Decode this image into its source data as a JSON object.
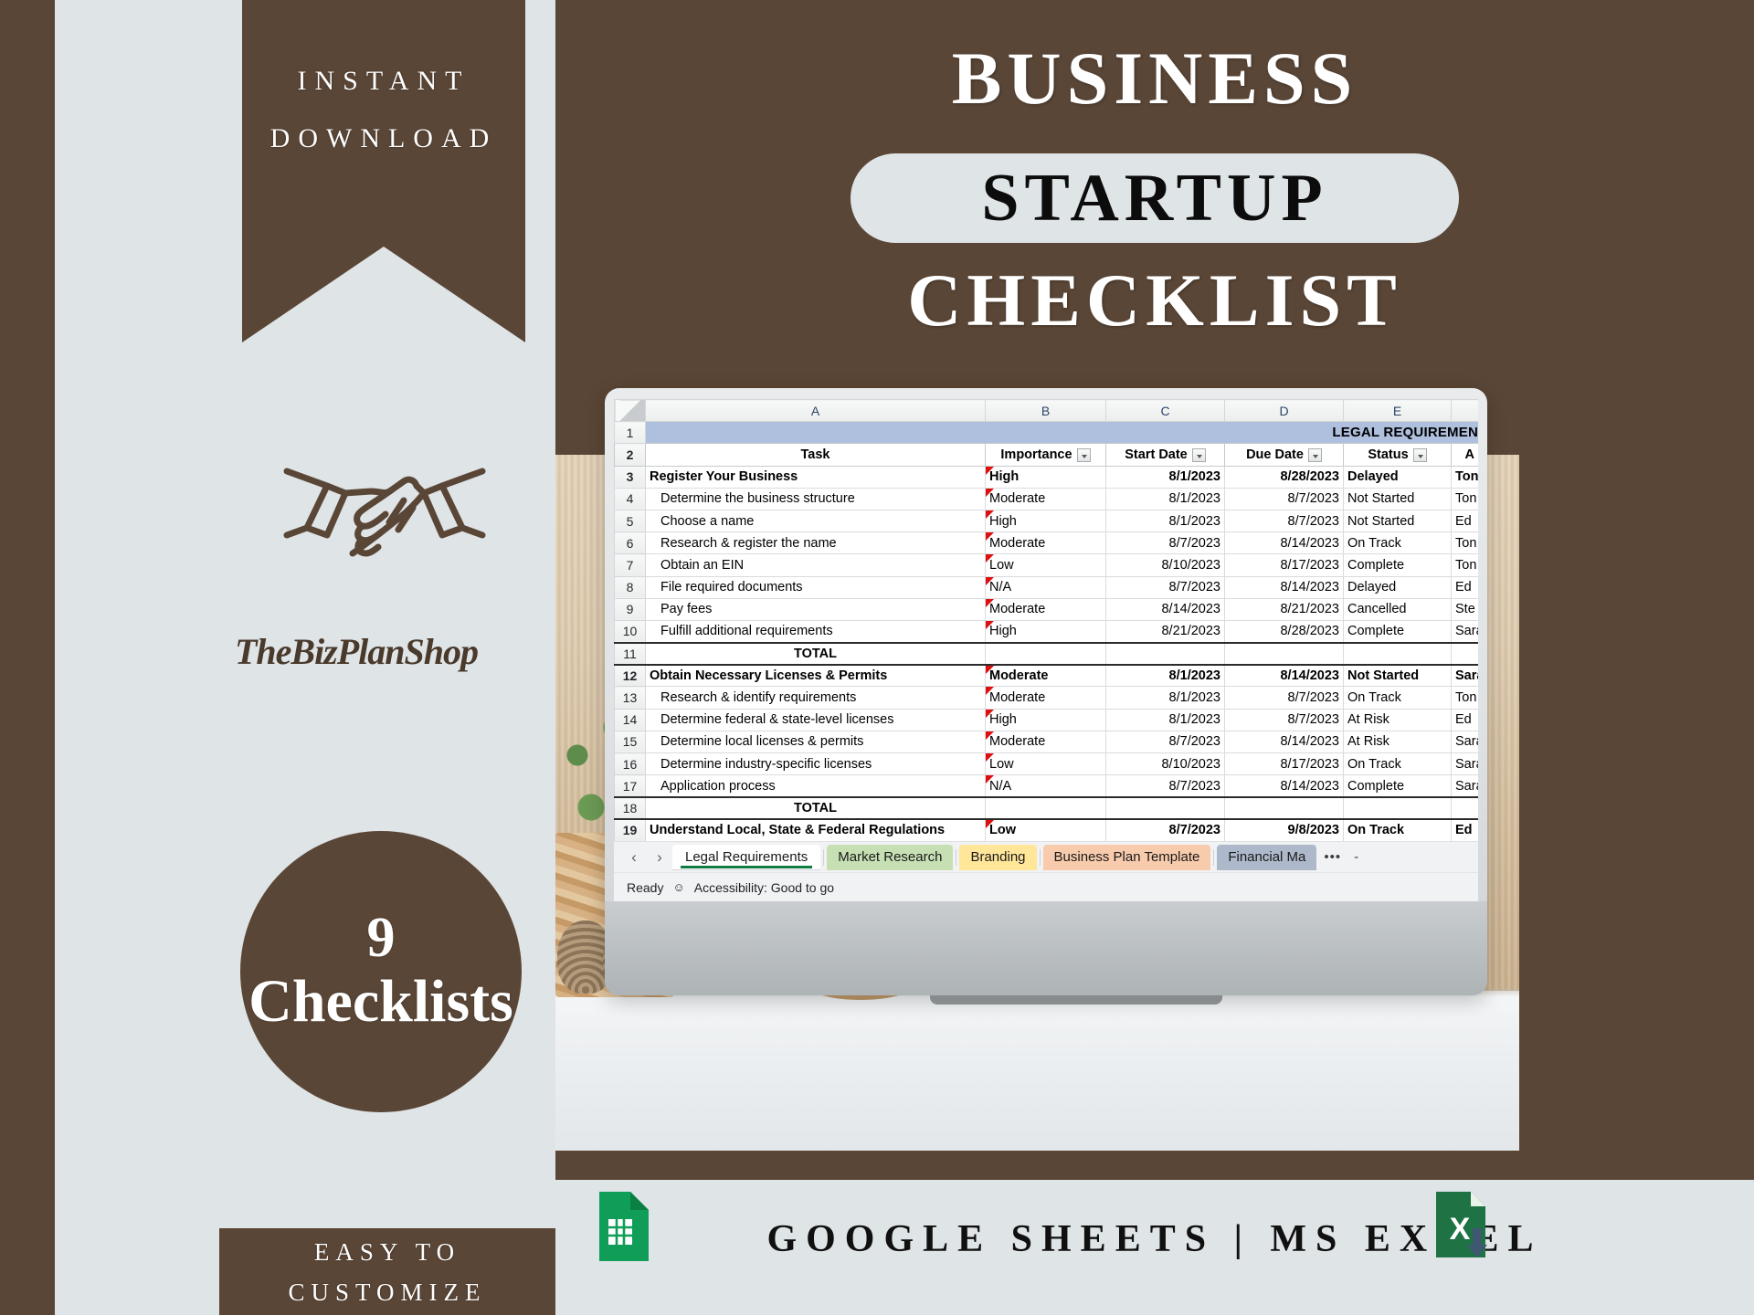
{
  "left_panel": {
    "ribbon_line1": "INSTANT",
    "ribbon_line2": "DOWNLOAD",
    "brand_name": "TheBizPlanShop",
    "badge_number": "9",
    "badge_label": "Checklists",
    "easy_line1": "EASY TO",
    "easy_line2": "CUSTOMIZE",
    "handshake_icon": "handshake-icon"
  },
  "header": {
    "line1": "BUSINESS",
    "line2": "STARTUP",
    "line3": "CHECKLIST"
  },
  "footer": {
    "text": "GOOGLE SHEETS | MS EXCEL",
    "gsheet_icon": "google-sheets-icon",
    "excel_icon": "ms-excel-icon"
  },
  "colors": {
    "brown": "#5a4636",
    "light_gray": "#dfe4e7",
    "excel_green": "#107c41",
    "sheets_green": "#0f9d58",
    "band_blue": "#aec0de"
  },
  "spreadsheet": {
    "column_letters": [
      "A",
      "B",
      "C",
      "D",
      "E"
    ],
    "sheet_title": "LEGAL REQUIREMEN",
    "headers": [
      "Task",
      "Importance",
      "Start Date",
      "Due Date",
      "Status",
      "A"
    ],
    "total_label": "TOTAL",
    "rows": [
      {
        "n": "1",
        "kind": "band"
      },
      {
        "n": "2",
        "kind": "header"
      },
      {
        "n": "3",
        "kind": "group",
        "task": "Register Your Business",
        "importance": "High",
        "start": "8/1/2023",
        "due": "8/28/2023",
        "status": "Delayed",
        "assigned": "Ton"
      },
      {
        "n": "4",
        "kind": "sub",
        "task": "Determine the business structure",
        "importance": "Moderate",
        "start": "8/1/2023",
        "due": "8/7/2023",
        "status": "Not Started",
        "assigned": "Ton"
      },
      {
        "n": "5",
        "kind": "sub",
        "task": "Choose a name",
        "importance": "High",
        "start": "8/1/2023",
        "due": "8/7/2023",
        "status": "Not Started",
        "assigned": "Ed"
      },
      {
        "n": "6",
        "kind": "sub",
        "task": "Research & register the name",
        "importance": "Moderate",
        "start": "8/7/2023",
        "due": "8/14/2023",
        "status": "On Track",
        "assigned": "Ton"
      },
      {
        "n": "7",
        "kind": "sub",
        "task": "Obtain an EIN",
        "importance": "Low",
        "start": "8/10/2023",
        "due": "8/17/2023",
        "status": "Complete",
        "assigned": "Ton"
      },
      {
        "n": "8",
        "kind": "sub",
        "task": "File required documents",
        "importance": "N/A",
        "start": "8/7/2023",
        "due": "8/14/2023",
        "status": "Delayed",
        "assigned": "Ed"
      },
      {
        "n": "9",
        "kind": "sub",
        "task": "Pay fees",
        "importance": "Moderate",
        "start": "8/14/2023",
        "due": "8/21/2023",
        "status": "Cancelled",
        "assigned": "Ste"
      },
      {
        "n": "10",
        "kind": "sub",
        "task": "Fulfill additional requirements",
        "importance": "High",
        "start": "8/21/2023",
        "due": "8/28/2023",
        "status": "Complete",
        "assigned": "Sara"
      },
      {
        "n": "11",
        "kind": "total",
        "task": "TOTAL",
        "importance": "",
        "start": "",
        "due": "",
        "status": "",
        "assigned": ""
      },
      {
        "n": "12",
        "kind": "group",
        "task": "Obtain Necessary Licenses & Permits",
        "importance": "Moderate",
        "start": "8/1/2023",
        "due": "8/14/2023",
        "status": "Not Started",
        "assigned": "Sara"
      },
      {
        "n": "13",
        "kind": "sub",
        "task": "Research & identify requirements",
        "importance": "Moderate",
        "start": "8/1/2023",
        "due": "8/7/2023",
        "status": "On Track",
        "assigned": "Ton"
      },
      {
        "n": "14",
        "kind": "sub",
        "task": "Determine federal & state-level licenses",
        "importance": "High",
        "start": "8/1/2023",
        "due": "8/7/2023",
        "status": "At Risk",
        "assigned": "Ed"
      },
      {
        "n": "15",
        "kind": "sub",
        "task": "Determine local licenses & permits",
        "importance": "Moderate",
        "start": "8/7/2023",
        "due": "8/14/2023",
        "status": "At Risk",
        "assigned": "Sara"
      },
      {
        "n": "16",
        "kind": "sub",
        "task": "Determine industry-specific licenses",
        "importance": "Low",
        "start": "8/10/2023",
        "due": "8/17/2023",
        "status": "On Track",
        "assigned": "Sara"
      },
      {
        "n": "17",
        "kind": "sub",
        "task": "Application process",
        "importance": "N/A",
        "start": "8/7/2023",
        "due": "8/14/2023",
        "status": "Complete",
        "assigned": "Sara"
      },
      {
        "n": "18",
        "kind": "total",
        "task": "TOTAL",
        "importance": "",
        "start": "",
        "due": "",
        "status": "",
        "assigned": ""
      },
      {
        "n": "19",
        "kind": "group",
        "task": "Understand Local, State & Federal Regulations",
        "importance": "Low",
        "start": "8/7/2023",
        "due": "9/8/2023",
        "status": "On Track",
        "assigned": "Ed"
      }
    ],
    "tabs": [
      {
        "label": "Legal Requirements",
        "color": "active"
      },
      {
        "label": "Market Research",
        "color": "g"
      },
      {
        "label": "Branding",
        "color": "y"
      },
      {
        "label": "Business Plan Template",
        "color": "o"
      },
      {
        "label": "Financial Ma",
        "color": "bl"
      }
    ],
    "tab_overflow": "•••",
    "tab_dash": "-",
    "nav_prev": "‹",
    "nav_next": "›",
    "status_ready": "Ready",
    "status_accessibility": "Accessibility: Good to go"
  }
}
